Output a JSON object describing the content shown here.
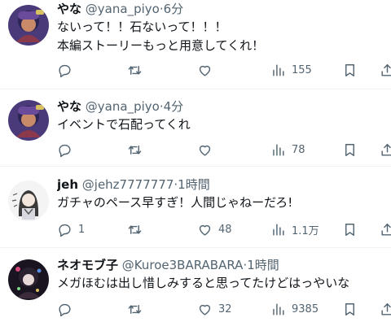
{
  "tweets": [
    {
      "name": "やな",
      "handle": "@yana_piyo",
      "time": "6分",
      "lines": [
        "ないって！！石ないって！！！",
        "本編ストーリーもっと用意してくれ！"
      ],
      "replies": "",
      "retweets": "",
      "likes": "",
      "views": "155"
    },
    {
      "name": "やな",
      "handle": "@yana_piyo",
      "time": "4分",
      "lines": [
        "イベントで石配ってくれ"
      ],
      "replies": "",
      "retweets": "",
      "likes": "",
      "views": "78"
    },
    {
      "name": "jeh",
      "handle": "@jehz7777777",
      "time": "1時間",
      "lines": [
        "ガチャのペース早すぎ！人間じゃねーだろ!"
      ],
      "replies": "1",
      "retweets": "",
      "likes": "48",
      "views": "1.1万"
    },
    {
      "name": "ネオモブ子",
      "handle": "@Kuroe3BARABARA",
      "time": "1時間",
      "lines": [
        "メガほむは出し惜しみすると思ってたけどはっやいな"
      ],
      "replies": "",
      "retweets": "",
      "likes": "32",
      "views": "9385"
    }
  ],
  "separator": "·",
  "colors": {
    "text": "#0f1419",
    "secondary": "#536471",
    "divider": "#eff3f4"
  },
  "icons": [
    "reply-icon",
    "retweet-icon",
    "like-icon",
    "views-icon",
    "bookmark-icon",
    "share-icon"
  ]
}
